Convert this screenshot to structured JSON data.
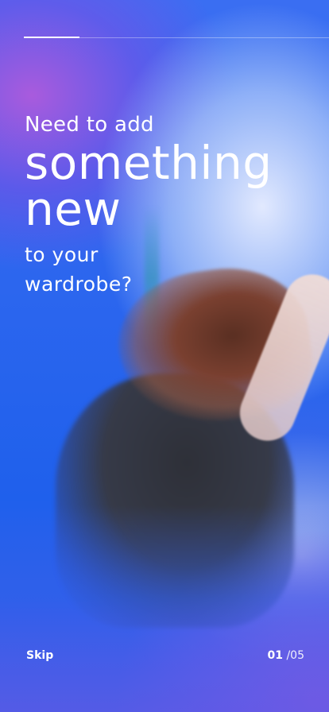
{
  "progress": {
    "fraction": 0.2
  },
  "headline": {
    "line1": "Need to add",
    "line2": "something",
    "line3": "new",
    "line4": "to your",
    "line5": "wardrobe?"
  },
  "footer": {
    "skip_label": "Skip",
    "current_page": "01",
    "separator": "/",
    "total_pages": "05"
  },
  "colors": {
    "text": "#ffffff",
    "accent_blue": "#1f60ec",
    "accent_purple": "#b05ad8"
  }
}
